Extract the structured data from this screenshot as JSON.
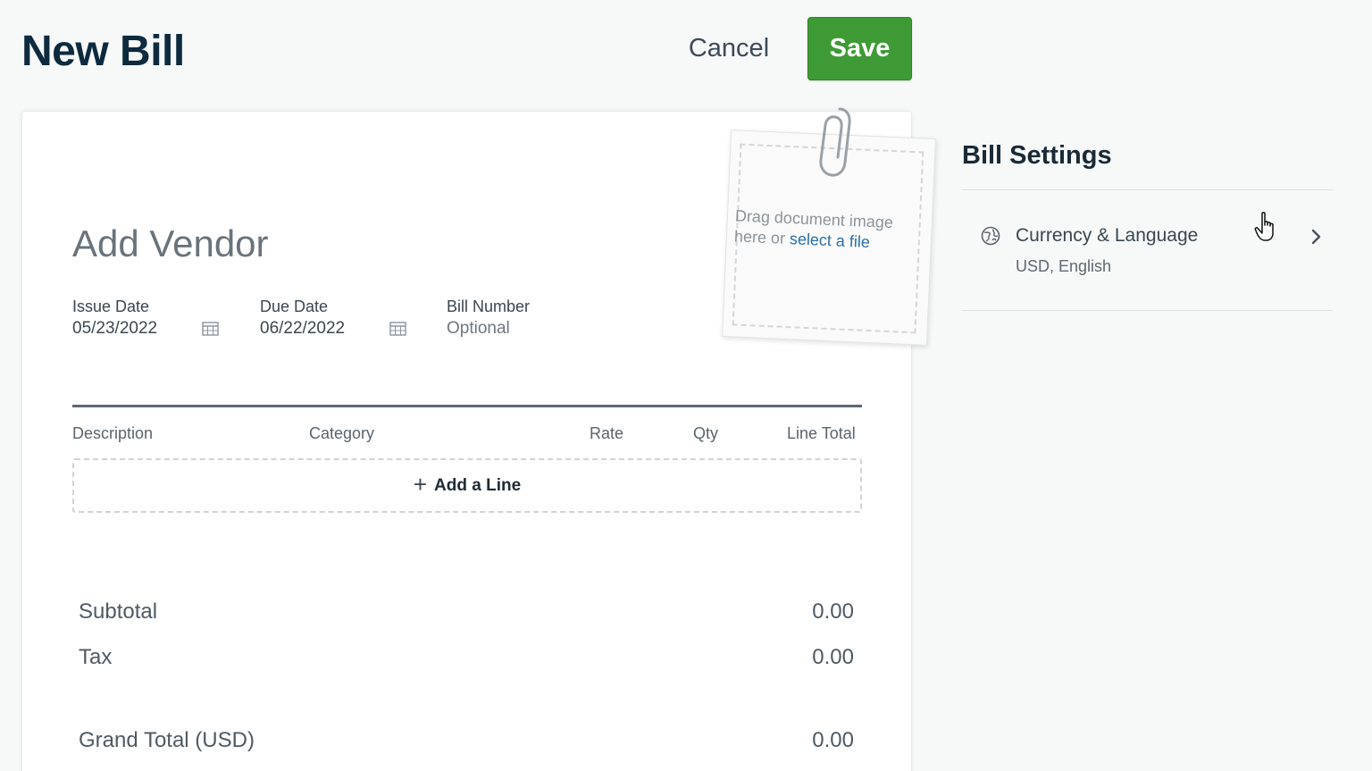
{
  "header": {
    "title": "New Bill",
    "cancel_label": "Cancel",
    "save_label": "Save"
  },
  "bill": {
    "vendor_placeholder": "Add Vendor",
    "issue_date": {
      "label": "Issue Date",
      "value": "05/23/2022"
    },
    "due_date": {
      "label": "Due Date",
      "value": "06/22/2022"
    },
    "bill_number": {
      "label": "Bill Number",
      "placeholder": "Optional"
    },
    "columns": [
      "Description",
      "Category",
      "Rate",
      "Qty",
      "Line Total"
    ],
    "add_line_label": "Add a Line",
    "totals": {
      "subtotal_label": "Subtotal",
      "subtotal_value": "0.00",
      "tax_label": "Tax",
      "tax_value": "0.00",
      "grand_total_label": "Grand Total (USD)",
      "grand_total_value": "0.00"
    }
  },
  "dropzone": {
    "text_line1": "Drag document image",
    "text_line2": "here or ",
    "link_text": "select a file"
  },
  "settings": {
    "title": "Bill Settings",
    "currency_language": {
      "label": "Currency & Language",
      "value": "USD, English"
    }
  },
  "icons": {
    "calendar": "calendar-icon",
    "paperclip": "paperclip-icon",
    "globe": "globe-icon",
    "chevron": "chevron-right-icon",
    "plus": "plus-icon",
    "cursor": "hand-pointer-icon"
  },
  "colors": {
    "save_button": "#3e9a35",
    "title": "#0d2a3e",
    "link": "#2a6fa8"
  }
}
